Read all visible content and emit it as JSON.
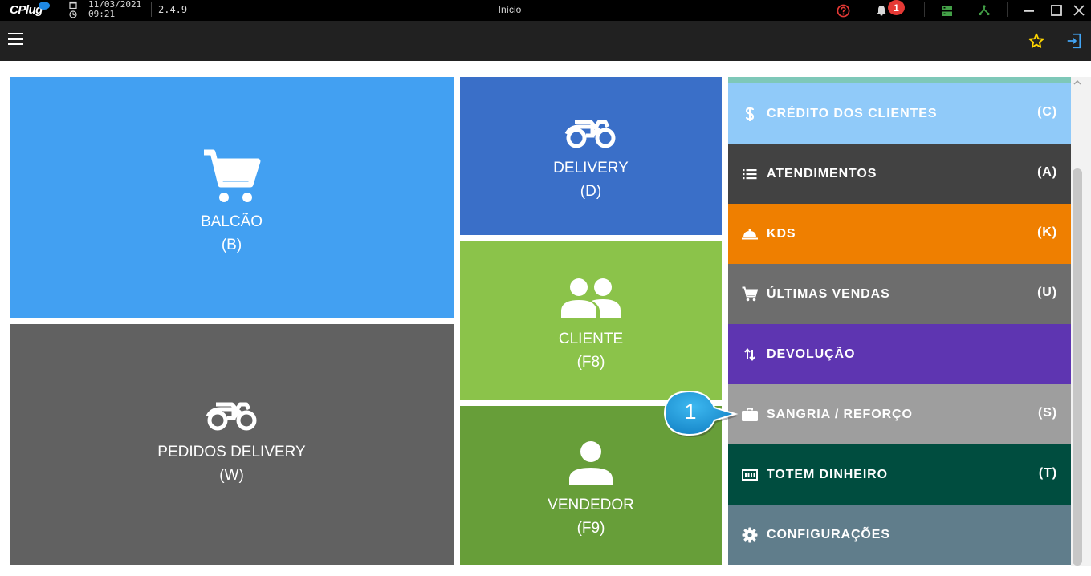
{
  "titlebar": {
    "logo": "CPlug",
    "date": "11/03/2021",
    "time": "09:21",
    "version": "2.4.9",
    "title": "Início",
    "notification_count": "1"
  },
  "tiles": {
    "balcao": {
      "label": "BALCÃO",
      "key": "(B)",
      "color": "#42a0f2"
    },
    "pedidos": {
      "label": "PEDIDOS DELIVERY",
      "key": "(W)",
      "color": "#616161"
    },
    "delivery": {
      "label": "DELIVERY",
      "key": "(D)",
      "color": "#3a6fc8"
    },
    "cliente": {
      "label": "CLIENTE",
      "key": "(F8)",
      "color": "#8bc34a"
    },
    "vendedor": {
      "label": "VENDEDOR",
      "key": "(F9)",
      "color": "#679e39"
    }
  },
  "side_menu": [
    {
      "label": "CRÉDITO DOS CLIENTES",
      "key": "(C)",
      "icon": "dollar-icon",
      "color": "#90caf9"
    },
    {
      "label": "ATENDIMENTOS",
      "key": "(A)",
      "icon": "list-icon",
      "color": "#424242"
    },
    {
      "label": "KDS",
      "key": "(K)",
      "icon": "cloche-icon",
      "color": "#ef7f00"
    },
    {
      "label": "ÚLTIMAS VENDAS",
      "key": "(U)",
      "icon": "cart-icon",
      "color": "#6d6d6d"
    },
    {
      "label": "DEVOLUÇÃO",
      "key": "",
      "icon": "swap-icon",
      "color": "#5e35b1"
    },
    {
      "label": "SANGRIA / REFORÇO",
      "key": "(S)",
      "icon": "briefcase-icon",
      "color": "#9e9e9e"
    },
    {
      "label": "TOTEM DINHEIRO",
      "key": "(T)",
      "icon": "cash-machine-icon",
      "color": "#004d3f"
    },
    {
      "label": "CONFIGURAÇÕES",
      "key": "",
      "icon": "gear-icon",
      "color": "#607d8b"
    }
  ],
  "callout": {
    "number": "1",
    "color": "#1e9fe0"
  }
}
